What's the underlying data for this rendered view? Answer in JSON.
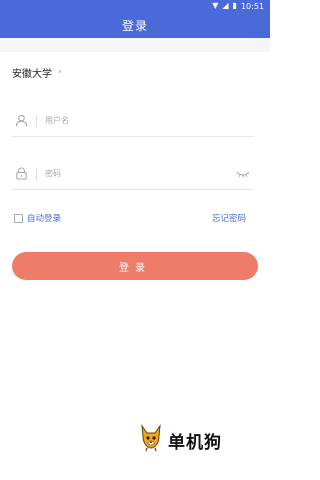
{
  "status_bar": {
    "time": "10:51",
    "icons": [
      "wifi-icon",
      "signal-icon",
      "battery-icon"
    ]
  },
  "header": {
    "title": "登录"
  },
  "school": {
    "name": "安徽大学",
    "chevron": "›"
  },
  "form": {
    "username_placeholder": "用户名",
    "username_value": "",
    "password_placeholder": "密码",
    "password_value": "",
    "remember_label": "自动登录",
    "forgot_label": "忘记密码",
    "login_label": "登录"
  },
  "watermark": {
    "text": "单机狗"
  },
  "colors": {
    "primary": "#4a6ad8",
    "button": "#ef7b69",
    "background": "#ffffff"
  }
}
